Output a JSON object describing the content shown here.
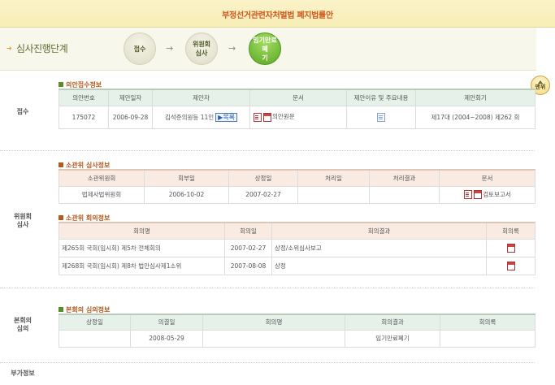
{
  "bill_title": "부정선거관련자처벌법 폐지법률안",
  "stage": {
    "label": "심사진행단계",
    "steps": [
      "접수",
      "위원회\n심사",
      "임기만료폐\n기"
    ]
  },
  "top_button_label": "맨위",
  "sections": {
    "reception": {
      "label": "접수",
      "subhead": "의안접수정보",
      "headers": [
        "의안번호",
        "제안일자",
        "제안자",
        "문서",
        "제안이유 및 주요내용",
        "제안회기"
      ],
      "row": {
        "bill_no": "175072",
        "date": "2006-09-28",
        "proposer": "김석준의원등 11인",
        "list_btn": "▶목록",
        "doc": "의안원문",
        "session": "제17대 (2004~2008) 제262 회"
      }
    },
    "committee": {
      "label": "위원회\n심사",
      "review_subhead": "소관위 심사정보",
      "review_headers": [
        "소관위원회",
        "회부일",
        "상정일",
        "처리일",
        "처리결과",
        "문서"
      ],
      "review_row": {
        "committee": "법제사법위원회",
        "referral_date": "2006-10-02",
        "presented_date": "2007-02-27",
        "processed_date": "",
        "result": "",
        "doc": "검토보고서"
      },
      "meeting_subhead": "소관위 회의정보",
      "meeting_headers": [
        "회의명",
        "회의일",
        "회의결과",
        "회의록"
      ],
      "meetings": [
        {
          "name": "제265회 국회(임시회) 제5차 전체회의",
          "date": "2007-02-27",
          "result": "상정/소위심사보고"
        },
        {
          "name": "제268회 국회(임시회) 제8차 법안심사제1소위",
          "date": "2007-08-08",
          "result": "상정"
        }
      ]
    },
    "plenary": {
      "label": "본회의\n심의",
      "subhead": "본회의 심의정보",
      "headers": [
        "상정일",
        "의결일",
        "회의명",
        "회의결과",
        "회의록"
      ],
      "row": {
        "presented_date": "",
        "decision_date": "2008-05-29",
        "meeting_name": "",
        "result": "임기만료폐기",
        "minutes": ""
      }
    },
    "extra": {
      "label": "부가정보"
    }
  },
  "colors": {
    "title_orange": "#d0561b",
    "green_step": "#5aa825",
    "table_header_green": "#e6f1ea",
    "table_header_peach": "#f9ebe2"
  }
}
